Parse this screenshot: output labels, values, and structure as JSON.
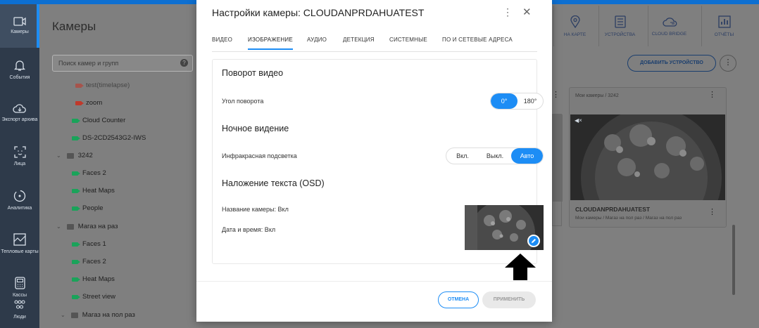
{
  "sidebar": {
    "items": [
      {
        "label": "Камеры",
        "icon": "camera-icon",
        "active": true
      },
      {
        "label": "События",
        "icon": "bell-icon"
      },
      {
        "label": "Экспорт архива",
        "icon": "cloud-download-icon"
      },
      {
        "label": "Лица",
        "icon": "face-scan-icon"
      },
      {
        "label": "Аналитика",
        "icon": "analytics-icon"
      },
      {
        "label": "Тепловые карты",
        "icon": "heatmap-icon"
      },
      {
        "label": "Кассы",
        "icon": "cash-register-icon"
      },
      {
        "label": "Люди",
        "icon": "people-icon"
      }
    ]
  },
  "page": {
    "title": "Камеры"
  },
  "search": {
    "placeholder": "Поиск камер и групп",
    "help": "?"
  },
  "tree": [
    {
      "label": "test(timelapse)",
      "type": "camera-red"
    },
    {
      "label": "zoom",
      "type": "camera-red"
    },
    {
      "label": "Cloud Counter",
      "type": "camera"
    },
    {
      "label": "DS-2CD2543G2-IWS",
      "type": "camera"
    },
    {
      "label": "3242",
      "type": "group"
    },
    {
      "label": "Faces 2",
      "type": "camera"
    },
    {
      "label": "Heat Maps",
      "type": "camera"
    },
    {
      "label": "People",
      "type": "camera"
    },
    {
      "label": "Магаз на раз",
      "type": "group"
    },
    {
      "label": "Faces 1",
      "type": "camera"
    },
    {
      "label": "Faces 2",
      "type": "camera"
    },
    {
      "label": "Heat Maps",
      "type": "camera"
    },
    {
      "label": "Street view",
      "type": "camera"
    },
    {
      "label": "Магаз на пол раз",
      "type": "group"
    }
  ],
  "header_buttons": [
    {
      "label": "НА КАРТЕ",
      "icon": "map-pin-icon"
    },
    {
      "label": "УСТРОЙСТВА",
      "icon": "devices-icon"
    },
    {
      "label": "CLOUD BRIDGE",
      "icon": "cloud-bridge-icon"
    },
    {
      "label": "ОТЧЁТЫ",
      "icon": "reports-icon"
    }
  ],
  "add_device": "ДОБАВИТЬ УСТРОЙСТВО",
  "more": "⋮",
  "cards": {
    "top_path": "Мои камеры / 3242",
    "bottom_name": "CLOUDANPRDAHUATEST",
    "bottom_path": "Мои камеры / Магаз на пол раз / Магаз на пол раз"
  },
  "dialog": {
    "title": "Настройки камеры: CLOUDANPRDAHUATEST",
    "menu": "⋮",
    "close": "✕",
    "tabs": [
      "ВИДЕО",
      "ИЗОБРАЖЕНИЕ",
      "АУДИО",
      "ДЕТЕКЦИЯ",
      "СИСТЕМНЫЕ",
      "ПО И СЕТЕВЫЕ АДРЕСА"
    ],
    "active_tab": "ИЗОБРАЖЕНИЕ",
    "rotation": {
      "heading": "Поворот видео",
      "label": "Угол поворота",
      "options": [
        "0°",
        "180°"
      ],
      "selected": "0°"
    },
    "night": {
      "heading": "Ночное видение",
      "label": "Инфракрасная подсветка",
      "options": [
        "Вкл.",
        "Выкл.",
        "Авто"
      ],
      "selected": "Авто"
    },
    "osd": {
      "heading": "Наложение текста (OSD)",
      "camera_name": "Название камеры: Вкл",
      "datetime": "Дата и время: Вкл"
    },
    "cancel": "ОТМЕНА",
    "apply": "ПРИМЕНИТЬ"
  },
  "colors": {
    "accent": "#1d8df5",
    "sidebar": "#2e3a4a",
    "overlay": "#7f7f7f"
  }
}
